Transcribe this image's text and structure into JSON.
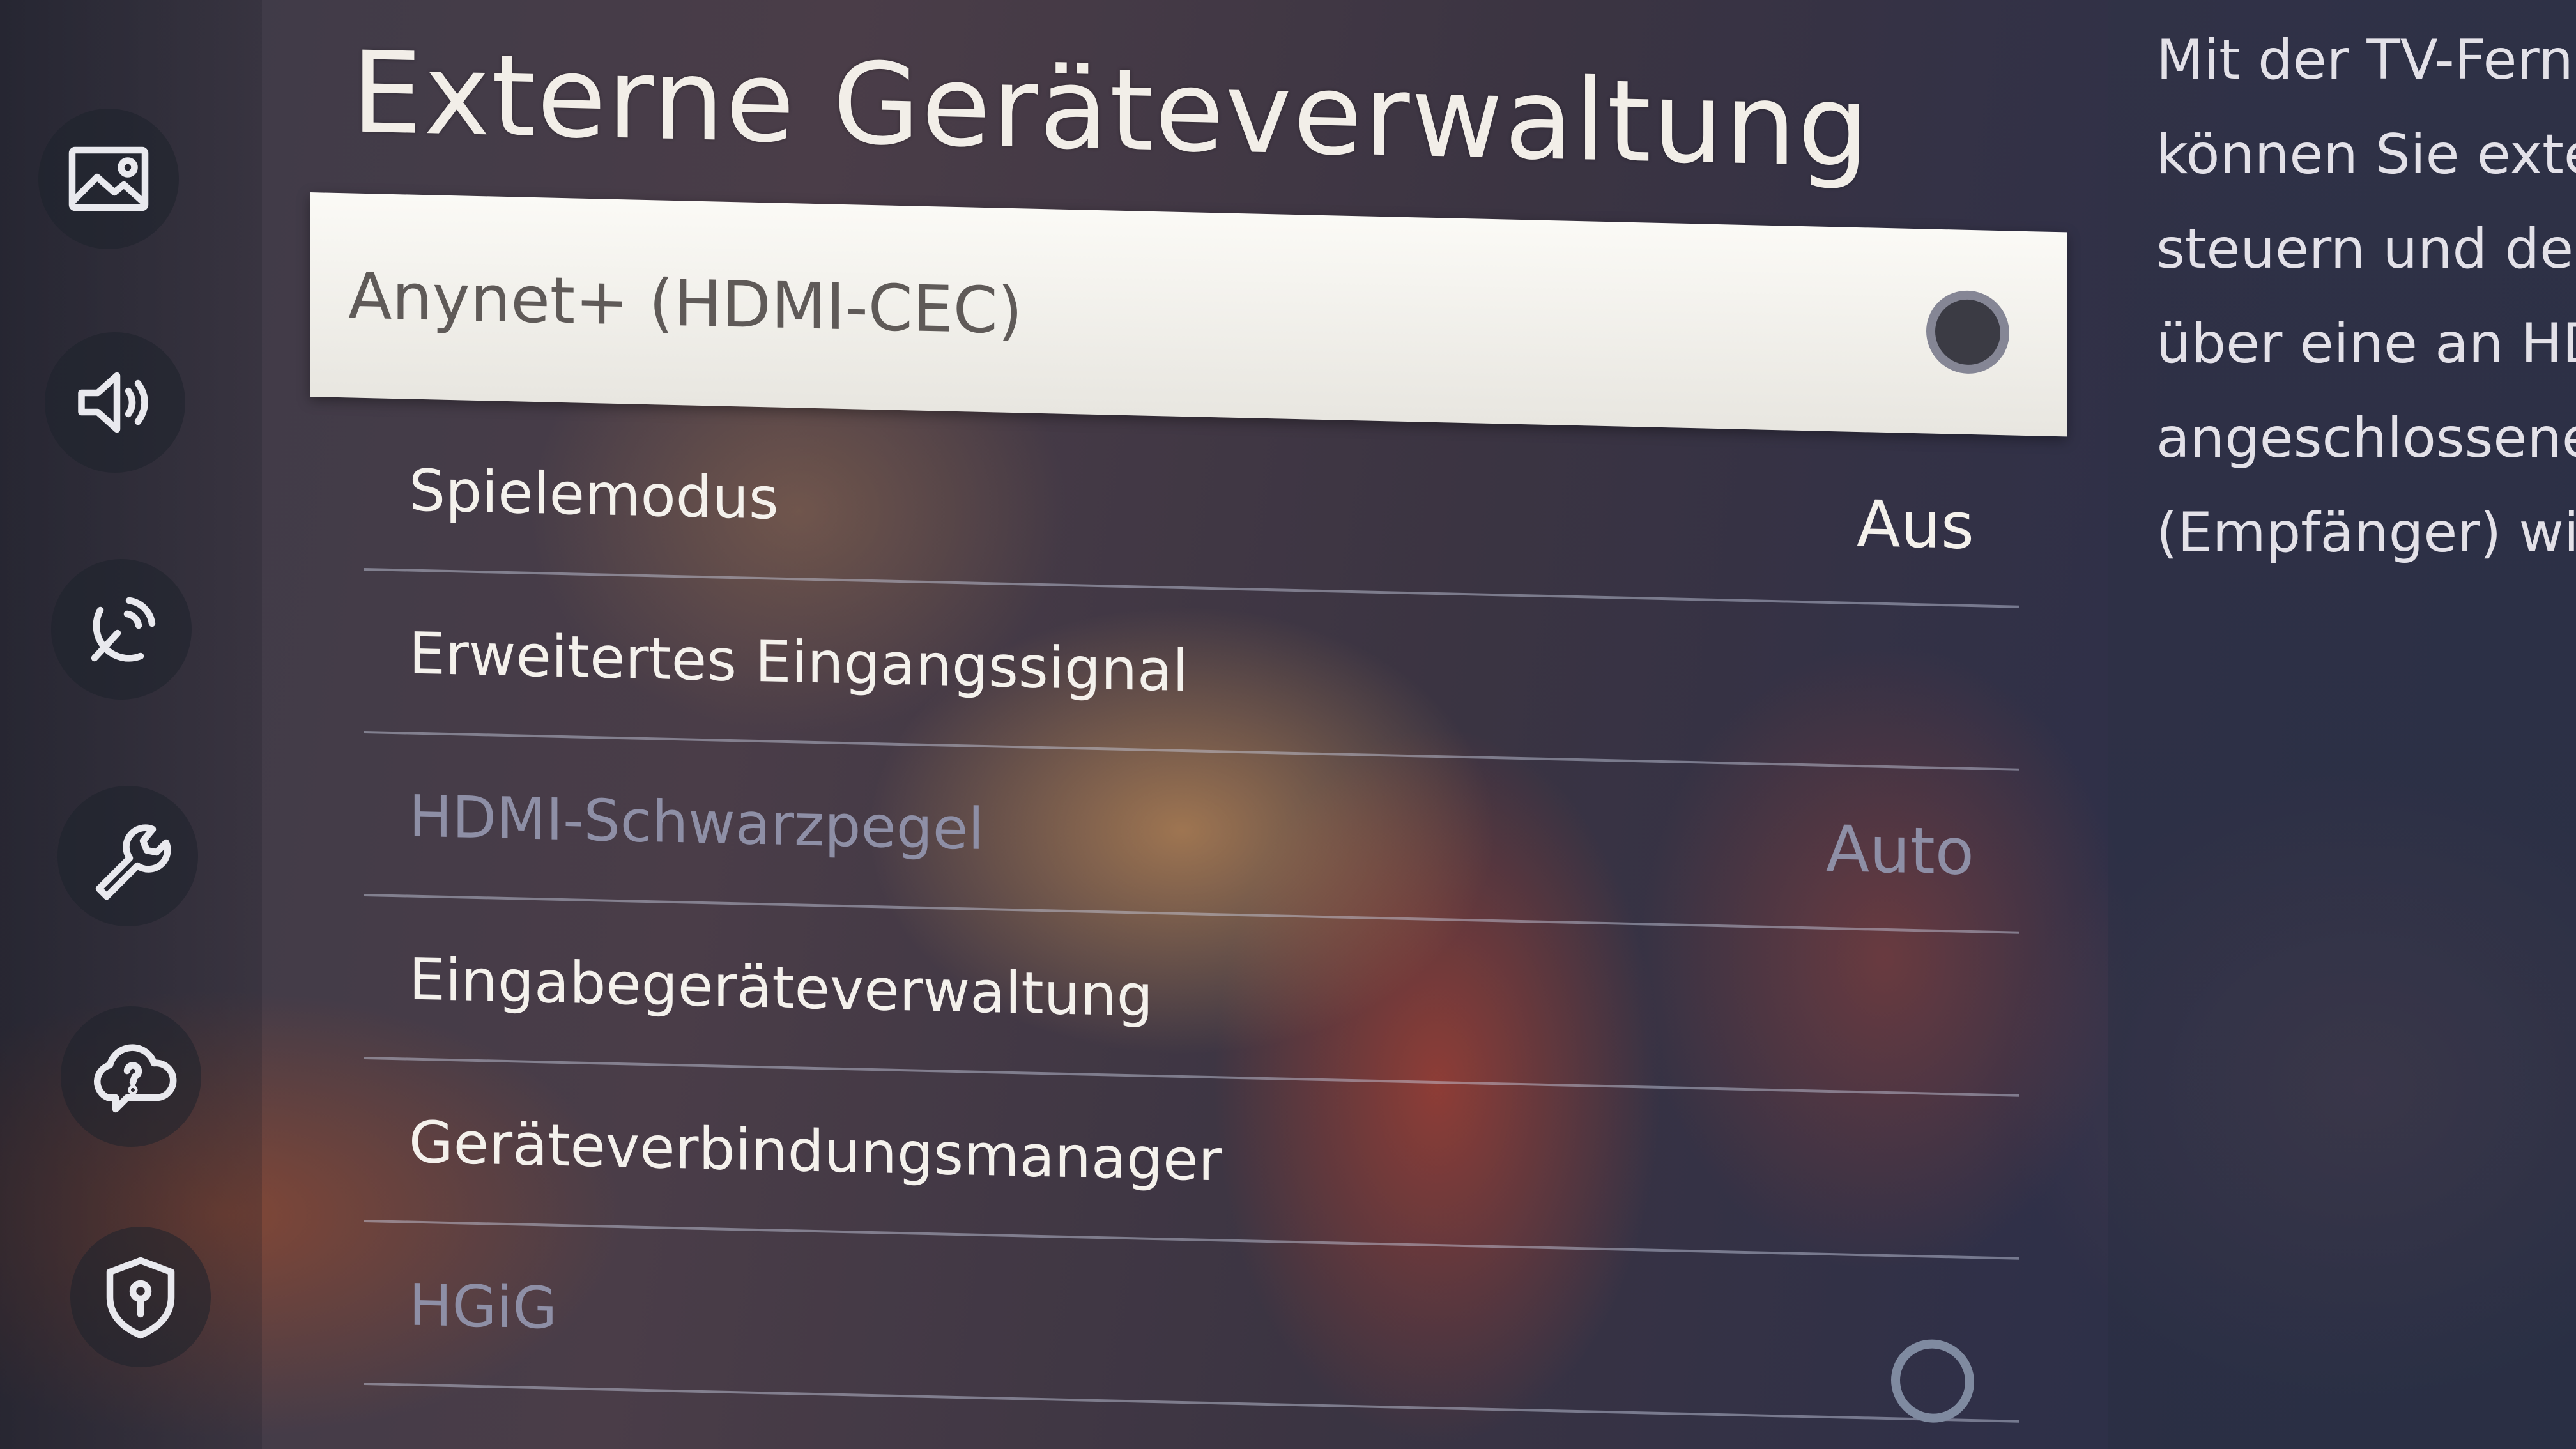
{
  "title": "Externe Geräteverwaltung",
  "sidebar": {
    "icons": [
      "picture-icon",
      "sound-icon",
      "broadcast-icon",
      "general-wrench-icon",
      "support-cloud-icon",
      "privacy-shield-icon"
    ]
  },
  "menu": {
    "items": [
      {
        "label": "Anynet+ (HDMI-CEC)",
        "toggle": "off",
        "state": "selected"
      },
      {
        "label": "Spielemodus",
        "value": "Aus"
      },
      {
        "label": "Erweitertes Eingangssignal"
      },
      {
        "label": "HDMI-Schwarzpegel",
        "value": "Auto",
        "state": "disabled"
      },
      {
        "label": "Eingabegeräteverwaltung"
      },
      {
        "label": "Geräteverbindungsmanager"
      },
      {
        "label": "HGiG",
        "toggle": "off",
        "state": "disabled"
      }
    ]
  },
  "description": {
    "lines": [
      "Mit der TV-Fernl",
      "können Sie exte",
      "steuern und den",
      "über eine an HDI",
      "angeschlossene",
      "(Empfänger) wie"
    ]
  }
}
